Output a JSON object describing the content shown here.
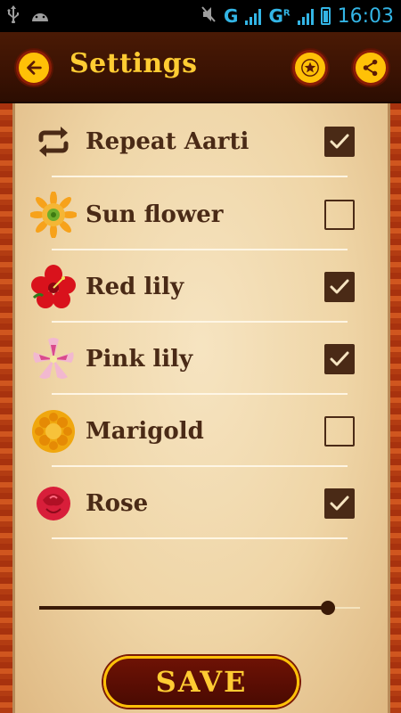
{
  "status_bar": {
    "network_1": "G",
    "network_2": "G",
    "network_2_sup": "R",
    "time": "16:03",
    "accent_color": "#33b5e5"
  },
  "app_bar": {
    "title": "Settings",
    "back_icon": "back-arrow-icon",
    "favorite_icon": "star-icon",
    "share_icon": "share-icon"
  },
  "settings": {
    "items": [
      {
        "label": "Repeat Aarti",
        "icon": "repeat-icon",
        "checked": true
      },
      {
        "label": "Sun flower",
        "icon": "sunflower-icon",
        "checked": false
      },
      {
        "label": "Red lily",
        "icon": "red-lily-icon",
        "checked": true
      },
      {
        "label": "Pink lily",
        "icon": "pink-lily-icon",
        "checked": true
      },
      {
        "label": "Marigold",
        "icon": "marigold-icon",
        "checked": false
      },
      {
        "label": "Rose",
        "icon": "rose-icon",
        "checked": true
      }
    ]
  },
  "slider": {
    "value": 0.9
  },
  "save_button": {
    "label": "SAVE"
  },
  "colors": {
    "accent": "#ffc107",
    "header_bg": "#3a1203",
    "text": "#4a2a16"
  }
}
